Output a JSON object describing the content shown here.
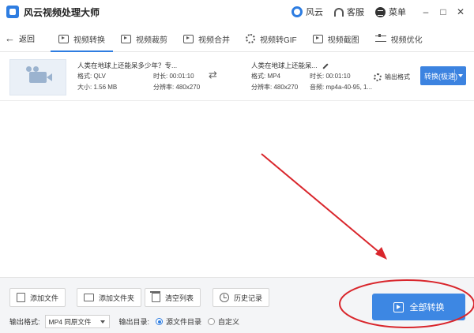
{
  "window": {
    "title": "风云视频处理大师",
    "user_label": "风云",
    "service_label": "客服",
    "menu_label": "菜单",
    "minimize": "–",
    "maximize": "□",
    "close": "✕"
  },
  "nav": {
    "back_label": "返回",
    "tabs": [
      {
        "label": "视频转换",
        "icon": "play-icon",
        "active": true
      },
      {
        "label": "视频裁剪",
        "icon": "crop-icon",
        "active": false
      },
      {
        "label": "视频合并",
        "icon": "merge-icon",
        "active": false
      },
      {
        "label": "视频转GIF",
        "icon": "gif-icon",
        "active": false
      },
      {
        "label": "视频截图",
        "icon": "screenshot-icon",
        "active": false
      },
      {
        "label": "视频优化",
        "icon": "sliders-icon",
        "active": false
      }
    ]
  },
  "file": {
    "source": {
      "name": "人类在地球上还能呆多少年？专...",
      "format": "格式: QLV",
      "duration": "时长: 00:01:10",
      "size": "大小: 1.56 MB",
      "resolution": "分辨率: 480x270"
    },
    "target": {
      "name": "人类在地球上还能呆...",
      "format": "格式: MP4",
      "duration": "时长: 00:01:10",
      "resolution": "分辨率: 480x270",
      "audio": "音频: mp4a-40-95, 1..."
    },
    "output_settings_label": "输出格式",
    "convert_mode_label": "转换(极速)"
  },
  "bottom": {
    "add_file": "添加文件",
    "add_folder": "添加文件夹",
    "clear_list": "清空列表",
    "history": "历史记录",
    "output_format_label": "输出格式:",
    "output_format_value": "MP4 同原文件",
    "output_dir_label": "输出目录:",
    "dir_option_source": "源文件目录",
    "dir_option_custom": "自定义",
    "selected_dir_option": "源文件目录",
    "convert_all": "全部转换"
  },
  "colors": {
    "accent": "#2e7de1",
    "button_blue": "#3d87e3",
    "annotation_red": "#d9262c"
  }
}
